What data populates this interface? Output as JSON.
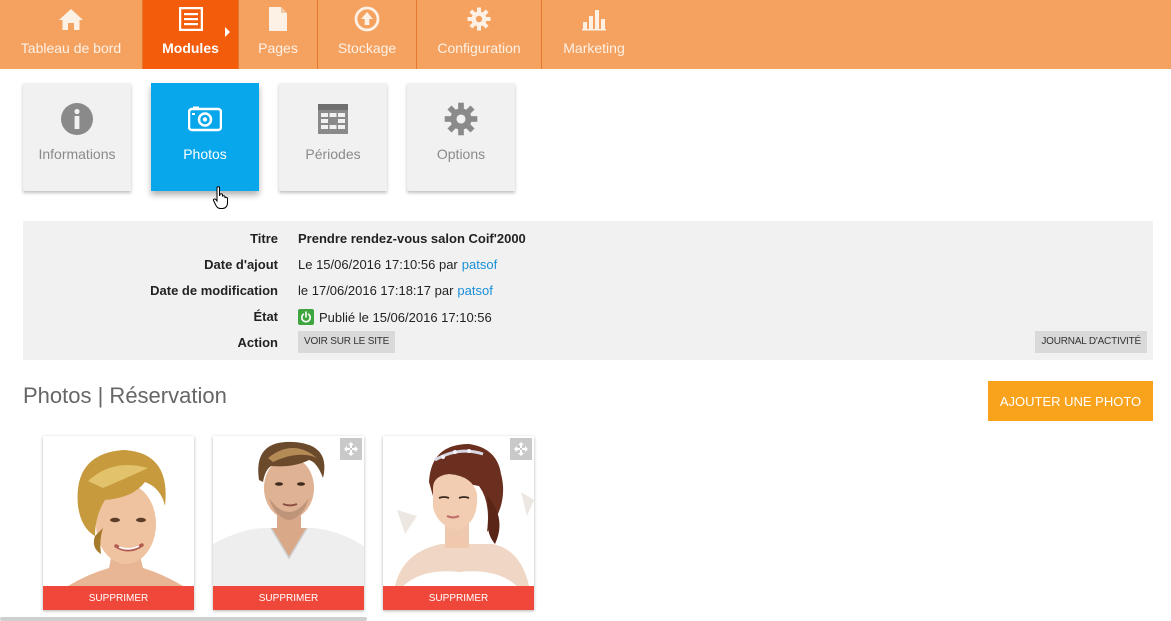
{
  "nav": {
    "items": [
      {
        "label": "Tableau de bord",
        "icon": "home-icon"
      },
      {
        "label": "Modules",
        "icon": "list-icon",
        "active": true
      },
      {
        "label": "Pages",
        "icon": "page-icon"
      },
      {
        "label": "Stockage",
        "icon": "upload-icon"
      },
      {
        "label": "Configuration",
        "icon": "gear-icon"
      },
      {
        "label": "Marketing",
        "icon": "bar-chart-icon"
      }
    ]
  },
  "tiles": [
    {
      "label": "Informations",
      "icon": "info-icon"
    },
    {
      "label": "Photos",
      "icon": "camera-icon",
      "active": true
    },
    {
      "label": "Périodes",
      "icon": "calendar-grid-icon"
    },
    {
      "label": "Options",
      "icon": "gear-icon"
    }
  ],
  "info": {
    "titre_label": "Titre",
    "titre_value": "Prendre rendez-vous salon Coif'2000",
    "ajout_label": "Date d'ajout",
    "ajout_text": "Le 15/06/2016 17:10:56 par",
    "ajout_user": "patsof",
    "modif_label": "Date de modification",
    "modif_text": "le 17/06/2016 17:18:17 par",
    "modif_user": "patsof",
    "etat_label": "État",
    "etat_text": "Publié le 15/06/2016 17:10:56",
    "action_label": "Action",
    "voir_btn": "VOIR SUR LE SITE",
    "journal_btn": "JOURNAL D'ACTIVITÉ"
  },
  "section": {
    "title": "Photos | Réservation",
    "add_btn": "AJOUTER UNE PHOTO"
  },
  "photos": [
    {
      "delete_label": "SUPPRIMER",
      "subject": "woman with short blonde hair"
    },
    {
      "delete_label": "SUPPRIMER",
      "subject": "man in white shirt"
    },
    {
      "delete_label": "SUPPRIMER",
      "subject": "bride with tiara"
    }
  ],
  "colors": {
    "nav_bg": "#f5a261",
    "nav_active": "#f25c0b",
    "tile_active": "#08a7ec",
    "link": "#1a8fd8",
    "add_btn": "#f9a21c",
    "delete_btn": "#f0473b",
    "status_green": "#3fa53f"
  }
}
